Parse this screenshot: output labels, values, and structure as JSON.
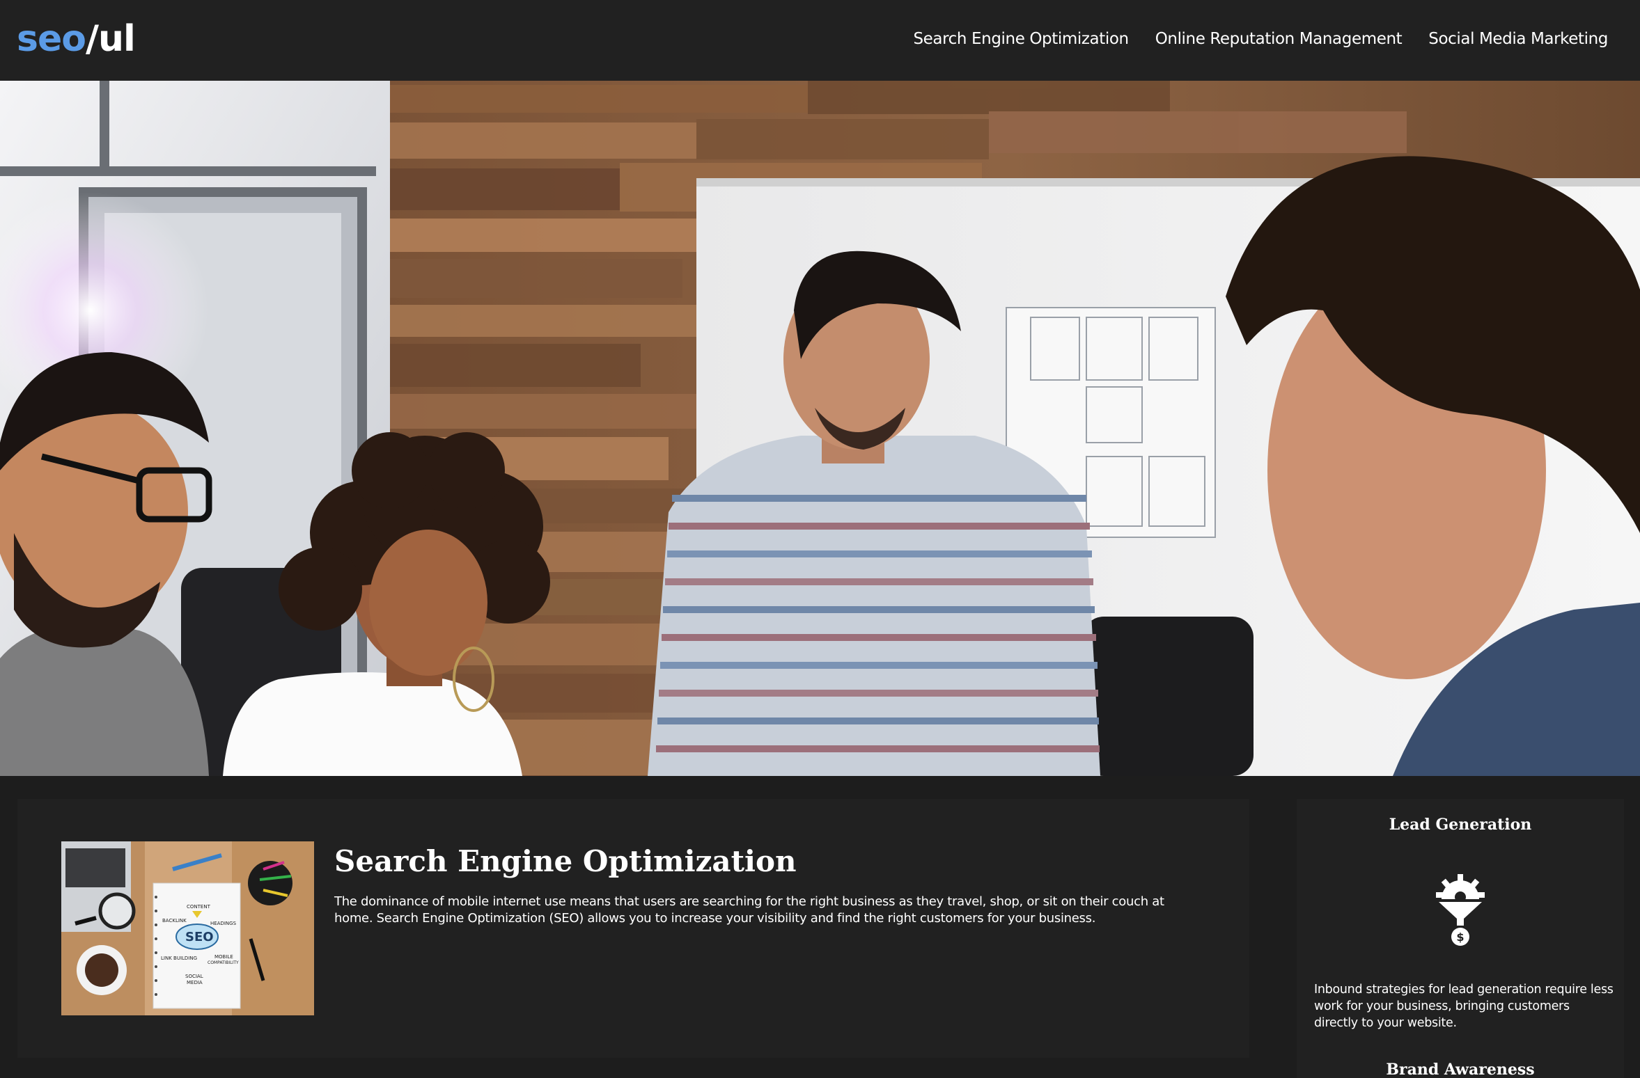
{
  "header": {
    "logo": {
      "part1": "seo",
      "part2": "/ul"
    },
    "nav": [
      {
        "label": "Search Engine Optimization"
      },
      {
        "label": "Online Reputation Management"
      },
      {
        "label": "Social Media Marketing"
      }
    ]
  },
  "hero": {
    "image": "team-meeting-photo"
  },
  "card": {
    "image": "seo-notebook-photo",
    "title": "Search Engine Optimization",
    "text": "The dominance of mobile internet use means that users are searching for the right business as they travel, shop, or sit on their couch at home. Search Engine Optimization (SEO) allows you to increase your visibility and find the right customers for your business.",
    "notebook_words": {
      "content": "CONTENT",
      "backlink": "BACKLINK",
      "headings": "HEADINGS",
      "seo": "SEO",
      "link_building": "LINK BUILDING",
      "mobile": "MOBILE",
      "compatibility": "COMPATIBILITY",
      "social": "SOCIAL",
      "media": "MEDIA"
    }
  },
  "sidebar": {
    "title": "Lead Generation",
    "icon": "funnel-gear-dollar-icon",
    "text": "Inbound strategies for lead generation require less work for your business, bringing customers directly to your website.",
    "next_title": "Brand Awareness"
  },
  "colors": {
    "background": "#1d1d1d",
    "panel": "#212121",
    "logo_accent": "#5b9be6",
    "text": "#ffffff"
  }
}
